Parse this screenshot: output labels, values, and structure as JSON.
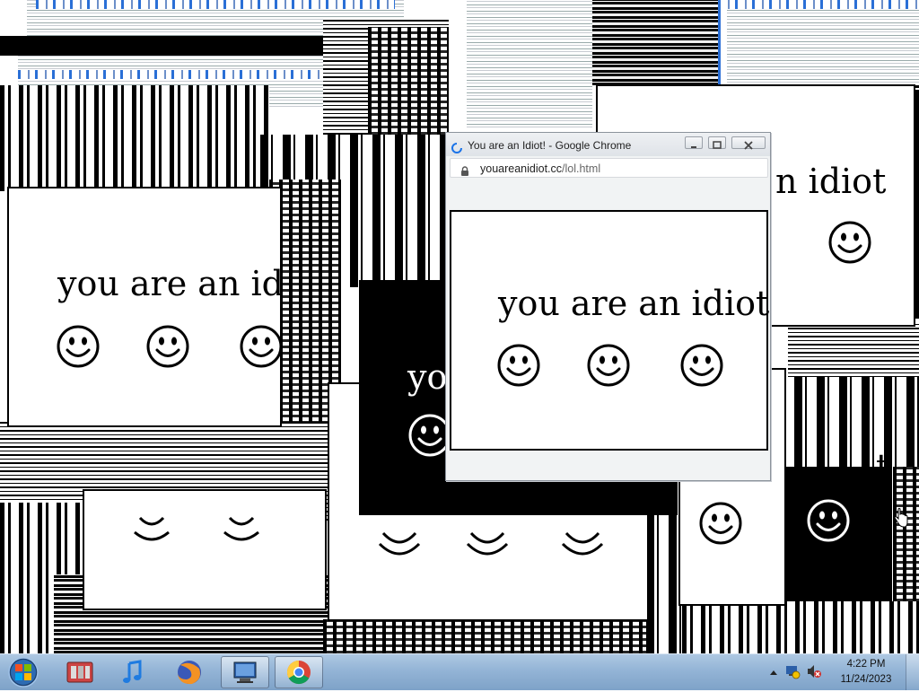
{
  "desktop": {
    "popup_text": "you are an idiot",
    "popup_text_cropped_left": "you are an idio",
    "popup_text_right_fragment": "n idiot",
    "popup_text_dark_fragment": "yo",
    "popup_text_t_fragment": "t"
  },
  "chrome": {
    "title": "You are an Idiot! - Google Chrome",
    "url_host": "youareanidiot.cc",
    "url_path": "/lol.html",
    "page_text": "you are an idiot"
  },
  "taskbar": {
    "items": [
      {
        "name": "Windows Media Center",
        "icon": "media-center-icon"
      },
      {
        "name": "iTunes",
        "icon": "itunes-icon"
      },
      {
        "name": "Firefox",
        "icon": "firefox-icon"
      },
      {
        "name": "Network",
        "icon": "network-icon",
        "active": true
      },
      {
        "name": "Google Chrome",
        "icon": "chrome-icon",
        "active": true
      }
    ],
    "clock_time": "4:22 PM",
    "clock_date": "11/24/2023"
  }
}
